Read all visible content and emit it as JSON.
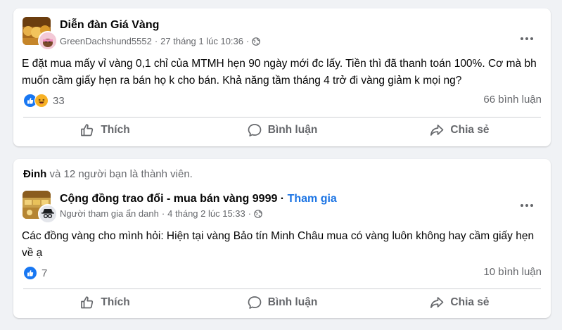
{
  "posts": [
    {
      "group_name": "Diễn đàn Giá Vàng",
      "author": "GreenDachshund5552",
      "separator": "·",
      "timestamp": "27 tháng 1 lúc 10:36",
      "visibility_icon": "globe-icon",
      "body": "E đặt mua mấy vỉ vàng 0,1 chỉ của MTMH hẹn 90 ngày mới đc lấy. Tiền thì đã thanh toán 100%.  Cơ mà bh muốn cầm giấy hẹn ra bán họ k cho bán. Khả năng  tầm tháng 4 trở đi vàng giảm k mọi ng?",
      "reaction_icons": [
        "like-icon",
        "haha-icon"
      ],
      "reaction_count": "33",
      "comment_count": "66 bình luận"
    },
    {
      "context_name": "Đinh",
      "context_rest": " và 12 người bạn là thành viên.",
      "group_name": "Cộng đồng trao đổi - mua bán vàng 9999",
      "join_separator": " · ",
      "join_label": "Tham gia",
      "author": "Người tham gia ẩn danh",
      "separator": "·",
      "timestamp": "4 tháng 2 lúc 15:33",
      "visibility_icon": "globe-icon",
      "body": "Các đồng vàng cho mình hỏi: Hiện tại vàng Bảo tín Minh Châu  mua có vàng luôn không hay cầm giấy hẹn về ạ",
      "reaction_icons": [
        "like-icon"
      ],
      "reaction_count": "7",
      "comment_count": "10 bình luận"
    }
  ],
  "actions": {
    "like": "Thích",
    "comment": "Bình luận",
    "share": "Chia sẻ"
  },
  "colors": {
    "page_bg": "#f0f2f5",
    "card_bg": "#ffffff",
    "text_primary": "#050505",
    "text_secondary": "#65676b",
    "accent": "#1b74e4",
    "like_blue": "#1877f2",
    "haha_yellow": "#f7b125"
  }
}
